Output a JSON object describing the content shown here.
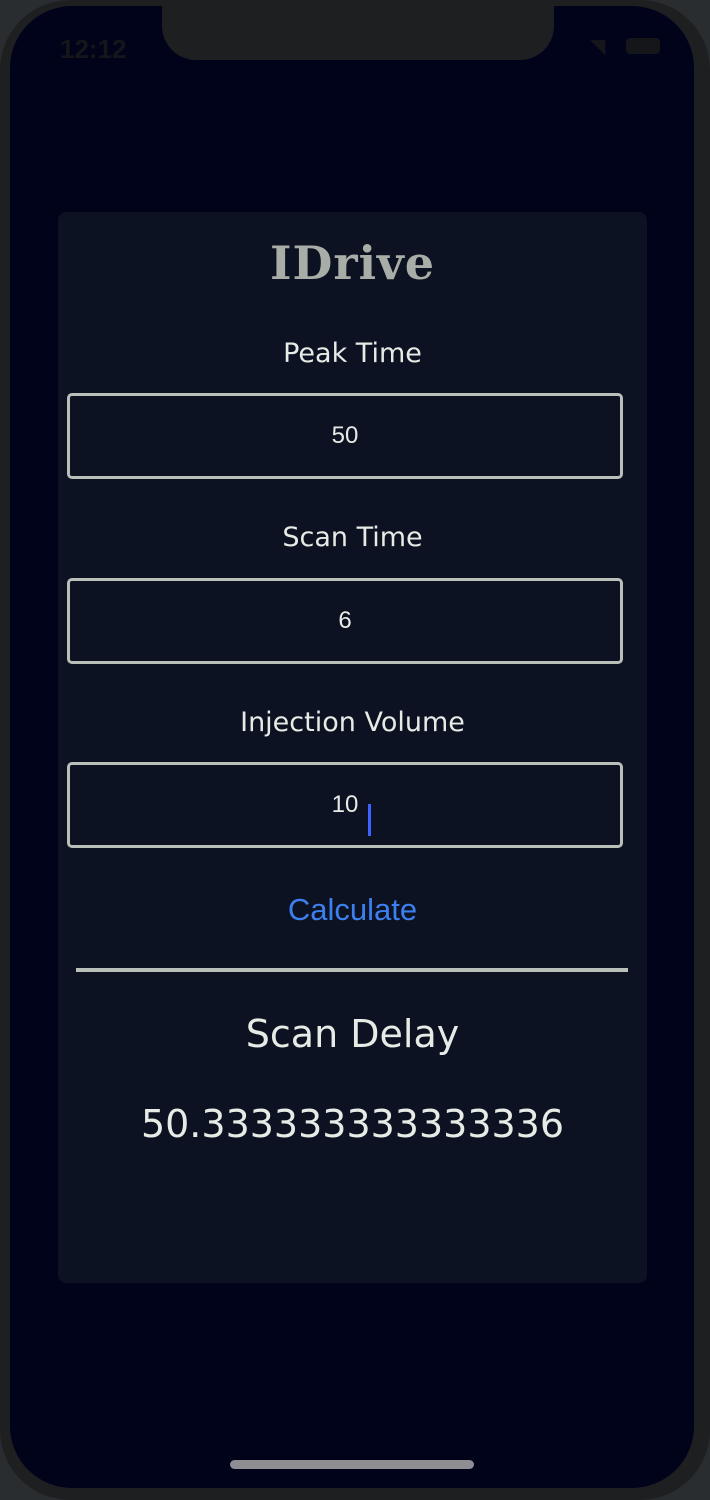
{
  "status_bar": {
    "time": "12:12"
  },
  "app": {
    "title": "IDrive"
  },
  "fields": [
    {
      "label": "Peak Time",
      "value": "50"
    },
    {
      "label": "Scan Time",
      "value": "6"
    },
    {
      "label": "Injection Volume",
      "value": "10"
    }
  ],
  "actions": {
    "calculate_label": "Calculate"
  },
  "result": {
    "title": "Scan Delay",
    "value": "50.333333333333336"
  },
  "colors": {
    "background": "#00031a",
    "card": "#0c1221",
    "accent": "#3c7fee",
    "text": "#e6ebe6"
  }
}
